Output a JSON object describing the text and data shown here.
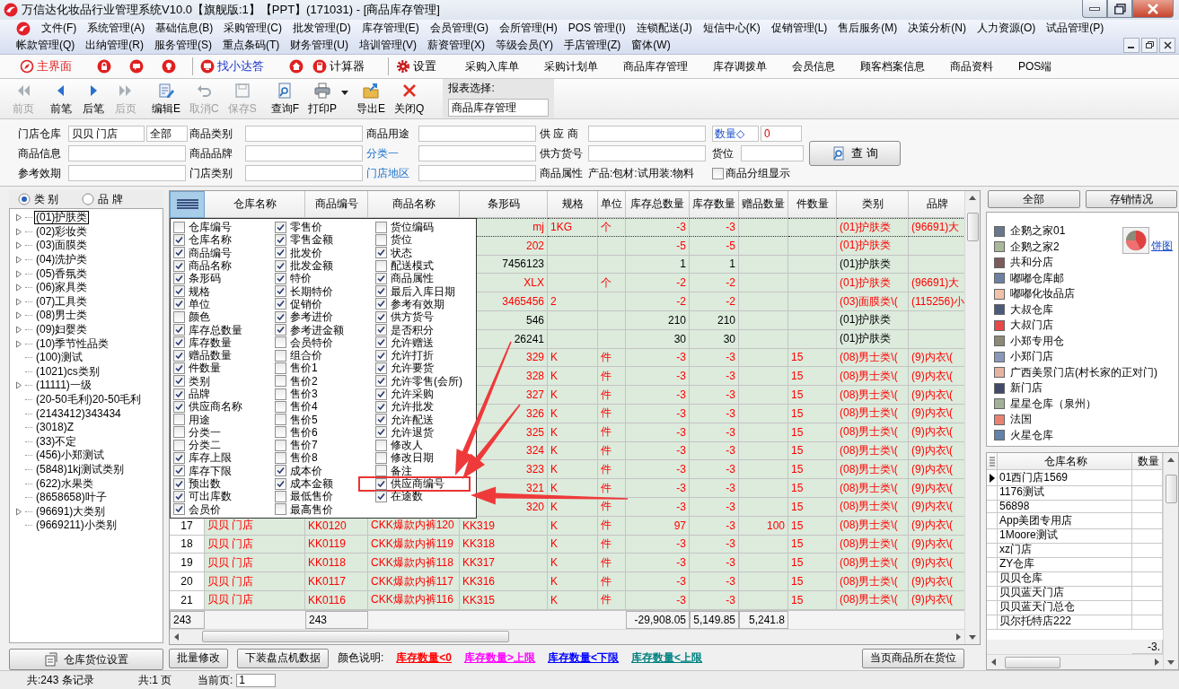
{
  "window": {
    "title": "万信达化妆品行业管理系统V10.0【旗舰版:1】【PPT】(171031) - [商品库存管理]"
  },
  "menu_rows": [
    [
      "文件(F)",
      "系统管理(A)",
      "基础信息(B)",
      "采购管理(C)",
      "批发管理(D)",
      "库存管理(E)",
      "会员管理(G)",
      "会所管理(H)",
      "POS 管理(I)",
      "连锁配送(J)",
      "短信中心(K)",
      "促销管理(L)",
      "售后服务(M)",
      "决策分析(N)",
      "人力资源(O)",
      "试品管理(P)"
    ],
    [
      "帐款管理(Q)",
      "出纳管理(R)",
      "服务管理(S)",
      "重点条码(T)",
      "财务管理(U)",
      "培训管理(V)",
      "薪资管理(X)",
      "等级会员(Y)",
      "手店管理(Z)",
      "窗体(W)"
    ]
  ],
  "quick_bar": [
    {
      "kind": "primary",
      "label": "主界面"
    },
    {
      "kind": "icon"
    },
    {
      "kind": "icon"
    },
    {
      "kind": "icon"
    },
    {
      "kind": "separator"
    },
    {
      "kind": "help",
      "label": "找小达答"
    },
    {
      "kind": "icon"
    },
    {
      "kind": "button",
      "label": "计算器"
    },
    {
      "kind": "separator"
    },
    {
      "kind": "button",
      "label": "设置"
    },
    {
      "kind": "text",
      "label": "采购入库单"
    },
    {
      "kind": "text",
      "label": "采购计划单"
    },
    {
      "kind": "text",
      "label": "商品库存管理"
    },
    {
      "kind": "text",
      "label": "库存调拨单"
    },
    {
      "kind": "text",
      "label": "会员信息"
    },
    {
      "kind": "text",
      "label": "顾客档案信息"
    },
    {
      "kind": "text",
      "label": "商品资料"
    },
    {
      "kind": "text",
      "label": "POS端"
    }
  ],
  "toolbar": [
    {
      "label": "前页",
      "disabled": true,
      "dropdown": false
    },
    {
      "label": "前笔",
      "disabled": false,
      "dropdown": false
    },
    {
      "label": "后笔",
      "disabled": false,
      "dropdown": false
    },
    {
      "label": "后页",
      "disabled": true,
      "dropdown": false
    },
    {
      "label": "编辑E",
      "disabled": false,
      "dropdown": false
    },
    {
      "label": "取消C",
      "disabled": true,
      "dropdown": false
    },
    {
      "label": "保存S",
      "disabled": true,
      "dropdown": false
    },
    {
      "label": "查询F",
      "disabled": false,
      "dropdown": false
    },
    {
      "label": "打印P",
      "disabled": false,
      "dropdown": true
    },
    {
      "label": "导出E",
      "disabled": false,
      "dropdown": false
    },
    {
      "label": "关闭Q",
      "disabled": false,
      "dropdown": false
    }
  ],
  "report_select": {
    "label": "报表选择:",
    "value": "商品库存管理"
  },
  "filters": [
    [
      {
        "kind": "label",
        "label": "门店仓库"
      },
      {
        "kind": "split",
        "values": [
          "贝贝 门店",
          "全部"
        ]
      },
      {
        "kind": "label",
        "label": "商品类别"
      },
      {
        "kind": "field"
      },
      {
        "kind": "label",
        "label": "商品用途"
      },
      {
        "kind": "field"
      },
      {
        "kind": "label",
        "label": "供 应 商"
      },
      {
        "kind": "field"
      },
      {
        "kind": "compare",
        "label": "数量◇",
        "value": "0"
      }
    ],
    [
      {
        "kind": "label",
        "label": "商品信息"
      },
      {
        "kind": "field"
      },
      {
        "kind": "label",
        "label": "商品品牌"
      },
      {
        "kind": "field"
      },
      {
        "kind": "link",
        "label": "分类一"
      },
      {
        "kind": "field"
      },
      {
        "kind": "label",
        "label": "供方货号"
      },
      {
        "kind": "field"
      },
      {
        "kind": "labeled_field",
        "label": "货位"
      }
    ],
    [
      {
        "kind": "label",
        "label": "参考效期"
      },
      {
        "kind": "field"
      },
      {
        "kind": "label",
        "label": "门店类别"
      },
      {
        "kind": "field"
      },
      {
        "kind": "link",
        "label": "门店地区"
      },
      {
        "kind": "field"
      },
      {
        "kind": "label",
        "label": "商品属性"
      },
      {
        "kind": "text",
        "label": "产品:包材:试用装:物料"
      },
      {
        "kind": "checkbox",
        "label": "商品分组显示",
        "checked": false
      }
    ]
  ],
  "query_button": {
    "label": "查 询"
  },
  "category_tree": {
    "modes": [
      {
        "label": "类 别",
        "selected": true
      },
      {
        "label": "品 牌",
        "selected": false
      }
    ],
    "items": [
      {
        "label": "(01)护肤类",
        "kind": "branch",
        "selected": true
      },
      {
        "label": "(02)彩妆类",
        "kind": "branch",
        "selected": false
      },
      {
        "label": "(03)面膜类",
        "kind": "branch",
        "selected": false
      },
      {
        "label": "(04)洗护类",
        "kind": "branch",
        "selected": false
      },
      {
        "label": "(05)香氛类",
        "kind": "branch",
        "selected": false
      },
      {
        "label": "(06)家具类",
        "kind": "branch",
        "selected": false
      },
      {
        "label": "(07)工具类",
        "kind": "branch",
        "selected": false
      },
      {
        "label": "(08)男士类",
        "kind": "branch",
        "selected": false
      },
      {
        "label": "(09)妇婴类",
        "kind": "branch",
        "selected": false
      },
      {
        "label": "(10)季节性品类",
        "kind": "branch",
        "selected": false
      },
      {
        "label": "(100)测试",
        "kind": "leaf",
        "selected": false
      },
      {
        "label": "(1021)cs类别",
        "kind": "leaf",
        "selected": false
      },
      {
        "label": "(11111)一级",
        "kind": "branch",
        "selected": false
      },
      {
        "label": "(20-50毛利)20-50毛利",
        "kind": "leaf",
        "selected": false
      },
      {
        "label": "(2143412)343434",
        "kind": "leaf",
        "selected": false
      },
      {
        "label": "(3018)Z",
        "kind": "leaf",
        "selected": false
      },
      {
        "label": "(33)不定",
        "kind": "leaf",
        "selected": false
      },
      {
        "label": "(456)小郑测试",
        "kind": "leaf",
        "selected": false
      },
      {
        "label": "(5848)1kj测试类别",
        "kind": "leaf",
        "selected": false
      },
      {
        "label": "(622)水果类",
        "kind": "leaf",
        "selected": false
      },
      {
        "label": "(8658658)叶子",
        "kind": "leaf",
        "selected": false
      },
      {
        "label": "(96691)大类别",
        "kind": "branch",
        "selected": false
      },
      {
        "label": "(9669211)小类别",
        "kind": "leaf",
        "selected": false
      }
    ]
  },
  "warehouse_button": "仓库货位设置",
  "stock_table": {
    "columns": [
      "仓库名称",
      "商品编号",
      "商品名称",
      "条形码",
      "规格",
      "单位",
      "库存总数量",
      "库存数量",
      "赠品数量",
      "件数量",
      "类别",
      "品牌"
    ],
    "rows": [
      {
        "selected": true,
        "color": "#ff0000",
        "barcode": "mj",
        "spec": "1KG",
        "unit": "个",
        "total_qty": "-3",
        "stock_qty": "-3",
        "category": "(01)护肤类",
        "brand": "(96691)大"
      },
      {
        "selected": false,
        "color": "#ff0000",
        "barcode": "202",
        "total_qty": "-5",
        "stock_qty": "-5",
        "category": "(01)护肤类"
      },
      {
        "selected": false,
        "color": "#000000",
        "barcode": "7456123",
        "total_qty": "1",
        "stock_qty": "1",
        "category": "(01)护肤类"
      },
      {
        "selected": false,
        "color": "#ff0000",
        "barcode": "XLX",
        "unit": "个",
        "total_qty": "-2",
        "stock_qty": "-2",
        "category": "(01)护肤类",
        "brand": "(96691)大"
      },
      {
        "selected": false,
        "color": "#ff0000",
        "barcode": "3465456",
        "spec": "2",
        "total_qty": "-2",
        "stock_qty": "-2",
        "category": "(03)面膜类\\(",
        "brand": "(115256)小"
      },
      {
        "selected": false,
        "color": "#000000",
        "barcode": "546",
        "total_qty": "210",
        "stock_qty": "210",
        "category": "(01)护肤类"
      },
      {
        "selected": false,
        "color": "#000000",
        "barcode": "26241",
        "total_qty": "30",
        "stock_qty": "30",
        "category": "(01)护肤类"
      },
      {
        "selected": false,
        "color": "#ff0000",
        "barcode": "329",
        "spec": "K",
        "unit": "件",
        "total_qty": "-3",
        "stock_qty": "-3",
        "piece_qty": "15",
        "category": "(08)男士类\\(",
        "brand": "(9)内衣\\("
      },
      {
        "selected": false,
        "color": "#ff0000",
        "barcode": "328",
        "spec": "K",
        "unit": "件",
        "total_qty": "-3",
        "stock_qty": "-3",
        "piece_qty": "15",
        "category": "(08)男士类\\(",
        "brand": "(9)内衣\\("
      },
      {
        "selected": false,
        "color": "#ff0000",
        "barcode": "327",
        "spec": "K",
        "unit": "件",
        "total_qty": "-3",
        "stock_qty": "-3",
        "piece_qty": "15",
        "category": "(08)男士类\\(",
        "brand": "(9)内衣\\("
      },
      {
        "selected": false,
        "color": "#ff0000",
        "barcode": "326",
        "spec": "K",
        "unit": "件",
        "total_qty": "-3",
        "stock_qty": "-3",
        "piece_qty": "15",
        "category": "(08)男士类\\(",
        "brand": "(9)内衣\\("
      },
      {
        "selected": false,
        "color": "#ff0000",
        "barcode": "325",
        "spec": "K",
        "unit": "件",
        "total_qty": "-3",
        "stock_qty": "-3",
        "piece_qty": "15",
        "category": "(08)男士类\\(",
        "brand": "(9)内衣\\("
      },
      {
        "selected": false,
        "color": "#ff0000",
        "barcode": "324",
        "spec": "K",
        "unit": "件",
        "total_qty": "-3",
        "stock_qty": "-3",
        "piece_qty": "15",
        "category": "(08)男士类\\(",
        "brand": "(9)内衣\\("
      },
      {
        "selected": false,
        "color": "#ff0000",
        "barcode": "323",
        "spec": "K",
        "unit": "件",
        "total_qty": "-3",
        "stock_qty": "-3",
        "piece_qty": "15",
        "category": "(08)男士类\\(",
        "brand": "(9)内衣\\("
      },
      {
        "selected": false,
        "color": "#ff0000",
        "barcode": "321",
        "spec": "K",
        "unit": "件",
        "total_qty": "-3",
        "stock_qty": "-3",
        "piece_qty": "15",
        "category": "(08)男士类\\(",
        "brand": "(9)内衣\\("
      },
      {
        "selected": false,
        "color": "#ff0000",
        "barcode": "320",
        "spec": "K",
        "unit": "件",
        "total_qty": "-3",
        "stock_qty": "-3",
        "piece_qty": "15",
        "category": "(08)男士类\\(",
        "brand": "(9)内衣\\("
      },
      {
        "selected": false,
        "color": "#ff0000",
        "number": "17",
        "warehouse": "贝贝 门店",
        "code": "KK0120",
        "name": "CKK爆款内裤120",
        "barcode": "KK319",
        "spec": "K",
        "unit": "件",
        "total_qty": "97",
        "stock_qty": "-3",
        "gift_qty": "100",
        "piece_qty": "15",
        "category": "(08)男士类\\(",
        "brand": "(9)内衣\\("
      },
      {
        "selected": false,
        "color": "#ff0000",
        "number": "18",
        "warehouse": "贝贝 门店",
        "code": "KK0119",
        "name": "CKK爆款内裤119",
        "barcode": "KK318",
        "spec": "K",
        "unit": "件",
        "total_qty": "-3",
        "stock_qty": "-3",
        "piece_qty": "15",
        "category": "(08)男士类\\(",
        "brand": "(9)内衣\\("
      },
      {
        "selected": false,
        "color": "#ff0000",
        "number": "19",
        "warehouse": "贝贝 门店",
        "code": "KK0118",
        "name": "CKK爆款内裤118",
        "barcode": "KK317",
        "spec": "K",
        "unit": "件",
        "total_qty": "-3",
        "stock_qty": "-3",
        "piece_qty": "15",
        "category": "(08)男士类\\(",
        "brand": "(9)内衣\\("
      },
      {
        "selected": false,
        "color": "#ff0000",
        "number": "20",
        "warehouse": "贝贝 门店",
        "code": "KK0117",
        "name": "CKK爆款内裤117",
        "barcode": "KK316",
        "spec": "K",
        "unit": "件",
        "total_qty": "-3",
        "stock_qty": "-3",
        "piece_qty": "15",
        "category": "(08)男士类\\(",
        "brand": "(9)内衣\\("
      },
      {
        "selected": false,
        "color": "#ff0000",
        "number": "21",
        "warehouse": "贝贝 门店",
        "code": "KK0116",
        "name": "CKK爆款内裤116",
        "barcode": "KK315",
        "spec": "K",
        "unit": "件",
        "total_qty": "-3",
        "stock_qty": "-3",
        "piece_qty": "15",
        "category": "(08)男士类\\(",
        "brand": "(9)内衣\\("
      }
    ],
    "totals": {
      "number": "243",
      "code": "243",
      "total_qty": "-29,908.05",
      "stock_qty": "5,149.85",
      "gift_qty": "5,241.8"
    }
  },
  "column_chooser": {
    "columns": [
      [
        {
          "label": "仓库编号",
          "checked": false,
          "highlighted": false
        },
        {
          "label": "仓库名称",
          "checked": true,
          "highlighted": false
        },
        {
          "label": "商品编号",
          "checked": true,
          "highlighted": false
        },
        {
          "label": "商品名称",
          "checked": true,
          "highlighted": false
        },
        {
          "label": "条形码",
          "checked": true,
          "highlighted": false
        },
        {
          "label": "规格",
          "checked": true,
          "highlighted": false
        },
        {
          "label": "单位",
          "checked": true,
          "highlighted": false
        },
        {
          "label": "颜色",
          "checked": false,
          "highlighted": false
        },
        {
          "label": "库存总数量",
          "checked": true,
          "highlighted": false
        },
        {
          "label": "库存数量",
          "checked": true,
          "highlighted": false
        },
        {
          "label": "赠品数量",
          "checked": true,
          "highlighted": false
        },
        {
          "label": "件数量",
          "checked": true,
          "highlighted": false
        },
        {
          "label": "类别",
          "checked": true,
          "highlighted": false
        },
        {
          "label": "品牌",
          "checked": true,
          "highlighted": false
        },
        {
          "label": "供应商名称",
          "checked": true,
          "highlighted": false
        },
        {
          "label": "用途",
          "checked": false,
          "highlighted": false
        },
        {
          "label": "分类一",
          "checked": false,
          "highlighted": false
        },
        {
          "label": "分类二",
          "checked": false,
          "highlighted": false
        },
        {
          "label": "库存上限",
          "checked": true,
          "highlighted": false
        },
        {
          "label": "库存下限",
          "checked": true,
          "highlighted": false
        },
        {
          "label": "预出数",
          "checked": true,
          "highlighted": false
        },
        {
          "label": "可出库数",
          "checked": true,
          "highlighted": false
        },
        {
          "label": "会员价",
          "checked": true,
          "highlighted": false
        }
      ],
      [
        {
          "label": "零售价",
          "checked": true,
          "highlighted": false
        },
        {
          "label": "零售金额",
          "checked": true,
          "highlighted": false
        },
        {
          "label": "批发价",
          "checked": true,
          "highlighted": false
        },
        {
          "label": "批发金额",
          "checked": true,
          "highlighted": false
        },
        {
          "label": "特价",
          "checked": true,
          "highlighted": false
        },
        {
          "label": "长期特价",
          "checked": true,
          "highlighted": false
        },
        {
          "label": "促销价",
          "checked": true,
          "highlighted": false
        },
        {
          "label": "参考进价",
          "checked": true,
          "highlighted": false
        },
        {
          "label": "参考进金额",
          "checked": true,
          "highlighted": false
        },
        {
          "label": "会员特价",
          "checked": false,
          "highlighted": false
        },
        {
          "label": "组合价",
          "checked": false,
          "highlighted": false
        },
        {
          "label": "售价1",
          "checked": false,
          "highlighted": false
        },
        {
          "label": "售价2",
          "checked": false,
          "highlighted": false
        },
        {
          "label": "售价3",
          "checked": false,
          "highlighted": false
        },
        {
          "label": "售价4",
          "checked": false,
          "highlighted": false
        },
        {
          "label": "售价5",
          "checked": false,
          "highlighted": false
        },
        {
          "label": "售价6",
          "checked": false,
          "highlighted": false
        },
        {
          "label": "售价7",
          "checked": false,
          "highlighted": false
        },
        {
          "label": "售价8",
          "checked": false,
          "highlighted": false
        },
        {
          "label": "成本价",
          "checked": true,
          "highlighted": false
        },
        {
          "label": "成本金额",
          "checked": true,
          "highlighted": false
        },
        {
          "label": "最低售价",
          "checked": false,
          "highlighted": false
        },
        {
          "label": "最高售价",
          "checked": false,
          "highlighted": false
        }
      ],
      [
        {
          "label": "货位编码",
          "checked": false,
          "highlighted": false
        },
        {
          "label": "货位",
          "checked": false,
          "highlighted": false
        },
        {
          "label": "状态",
          "checked": true,
          "highlighted": false
        },
        {
          "label": "配送模式",
          "checked": false,
          "highlighted": false
        },
        {
          "label": "商品属性",
          "checked": true,
          "highlighted": false
        },
        {
          "label": "最后入库日期",
          "checked": true,
          "highlighted": false
        },
        {
          "label": "参考有效期",
          "checked": true,
          "highlighted": false
        },
        {
          "label": "供方货号",
          "checked": true,
          "highlighted": false
        },
        {
          "label": "是否积分",
          "checked": true,
          "highlighted": false
        },
        {
          "label": "允许赠送",
          "checked": true,
          "highlighted": false
        },
        {
          "label": "允许打折",
          "checked": true,
          "highlighted": false
        },
        {
          "label": "允许要货",
          "checked": true,
          "highlighted": false
        },
        {
          "label": "允许零售(会所)",
          "checked": true,
          "highlighted": false
        },
        {
          "label": "允许采购",
          "checked": true,
          "highlighted": false
        },
        {
          "label": "允许批发",
          "checked": true,
          "highlighted": false
        },
        {
          "label": "允许配送",
          "checked": true,
          "highlighted": false
        },
        {
          "label": "允许退货",
          "checked": true,
          "highlighted": false
        },
        {
          "label": "修改人",
          "checked": false,
          "highlighted": false
        },
        {
          "label": "修改日期",
          "checked": false,
          "highlighted": false
        },
        {
          "label": "备注",
          "checked": false,
          "highlighted": false
        },
        {
          "label": "供应商编号",
          "checked": true,
          "highlighted": true
        },
        {
          "label": "在途数",
          "checked": true,
          "highlighted": false
        }
      ]
    ]
  },
  "stock_panel": {
    "buttons": [
      "全部",
      "存销情况"
    ],
    "chart_link": "饼图",
    "legend": [
      {
        "label": "企鹅之家01",
        "color": "#68778a"
      },
      {
        "label": "企鹅之家2",
        "color": "#a9b89b"
      },
      {
        "label": "共和分店",
        "color": "#7d5b5b"
      },
      {
        "label": "嘟嘟仓库邮",
        "color": "#6d81a3"
      },
      {
        "label": "嘟嘟化妆品店",
        "color": "#f1c2aa"
      },
      {
        "label": "大叔仓库",
        "color": "#4b5a79"
      },
      {
        "label": "大叔门店",
        "color": "#e84848"
      },
      {
        "label": "小郑专用仓",
        "color": "#8b8a79"
      },
      {
        "label": "小郑门店",
        "color": "#8a99b9"
      },
      {
        "label": "广西美景门店(村长家的正对门)",
        "color": "#e8b2a2"
      },
      {
        "label": "新门店",
        "color": "#414b69"
      },
      {
        "label": "星星仓库（泉州）",
        "color": "#a1b199"
      },
      {
        "label": "法国",
        "color": "#e98272"
      },
      {
        "label": "火星仓库",
        "color": "#6282a9"
      }
    ],
    "grid": {
      "columns": [
        "仓库名称",
        "数量"
      ],
      "rows": [
        {
          "name": "01西门店1569",
          "selected": true
        },
        {
          "name": "1176测试",
          "selected": false
        },
        {
          "name": "56898",
          "selected": false
        },
        {
          "name": "App美团专用店",
          "selected": false
        },
        {
          "name": "1Moore测试",
          "selected": false
        },
        {
          "name": "xz门店",
          "selected": false
        },
        {
          "name": "ZY仓库",
          "selected": false
        },
        {
          "name": "贝贝仓库",
          "selected": false
        },
        {
          "name": "贝贝蓝天门店",
          "selected": false
        },
        {
          "name": "贝贝蓝天门总仓",
          "selected": false
        },
        {
          "name": "贝尔托特店222",
          "selected": false
        }
      ],
      "footer": "-3."
    }
  },
  "actions": [
    "批量修改",
    "下装盘点机数据"
  ],
  "color_legend": {
    "label": "颜色说明:",
    "items": [
      {
        "label": "库存数量<0",
        "color": "#ff0000"
      },
      {
        "label": "库存数量>上限",
        "color": "#ff00ff"
      },
      {
        "label": "库存数量<下限",
        "color": "#0000ff"
      },
      {
        "label": "库存数量<上限",
        "color": "#008080"
      }
    ]
  },
  "location_button": "当页商品所在货位",
  "status_bar": {
    "records": "共:243 条记录",
    "pages": "共:1 页",
    "current_label": "当前页:",
    "current_value": "1"
  }
}
